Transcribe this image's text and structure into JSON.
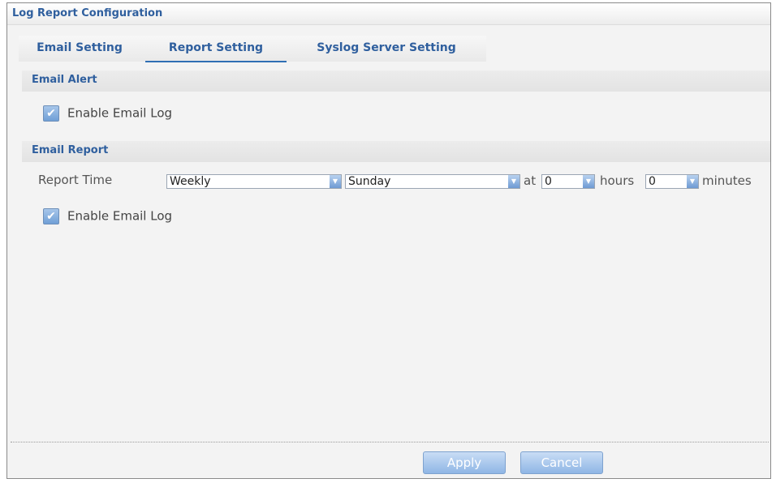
{
  "window": {
    "title": "Log Report Configuration"
  },
  "tabs": [
    {
      "label": "Email Setting",
      "active": false
    },
    {
      "label": "Report Setting",
      "active": true
    },
    {
      "label": "Syslog Server Setting",
      "active": false
    }
  ],
  "email_alert": {
    "heading": "Email Alert",
    "enable_label": "Enable Email Log",
    "enabled": true
  },
  "email_report": {
    "heading": "Email Report",
    "report_time_label": "Report Time",
    "frequency": "Weekly",
    "day": "Sunday",
    "at_label": "at",
    "hour": "0",
    "hours_label": "hours",
    "minute": "0",
    "minutes_label": "minutes",
    "enable_label": "Enable Email Log",
    "enabled": true
  },
  "buttons": {
    "apply": "Apply",
    "cancel": "Cancel"
  },
  "icons": {
    "checkbox": "checkmark-icon",
    "dropdown": "dropdown-arrow-icon"
  },
  "colors": {
    "accent": "#2f5f9e",
    "button": "#8fb6e5"
  }
}
